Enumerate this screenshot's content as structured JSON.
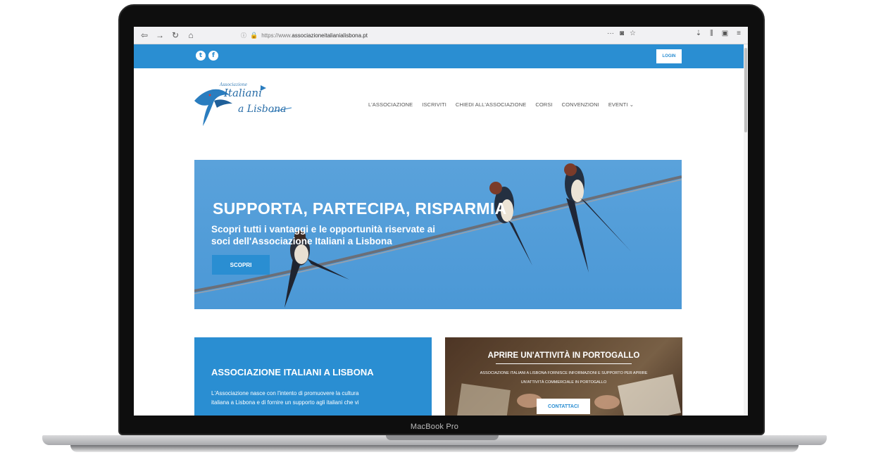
{
  "device": {
    "label": "MacBook Pro"
  },
  "browser": {
    "url_prefix": "https://www.",
    "url_domain": "associazioneitalianialisbona.pt",
    "icons": [
      "back-icon",
      "forward-icon",
      "reload-icon",
      "home-icon",
      "info-icon",
      "lock-icon",
      "more-icon",
      "pocket-icon",
      "bookmark-star-icon",
      "download-icon",
      "library-icon",
      "sidebar-icon",
      "menu-icon"
    ]
  },
  "site": {
    "colors": {
      "primary": "#2a8ed2",
      "hero_bg": "#5aa2db"
    },
    "topbar": {
      "social": [
        "t",
        "f"
      ],
      "login_label": "LOGIN"
    },
    "logo": {
      "small": "Associazione",
      "line1": "Italiani",
      "line2": "a Lisbona"
    },
    "nav": [
      {
        "label": "L'ASSOCIAZIONE"
      },
      {
        "label": "ISCRIVITI"
      },
      {
        "label": "CHIEDI ALL'ASSOCIAZIONE"
      },
      {
        "label": "CORSI"
      },
      {
        "label": "CONVENZIONI"
      },
      {
        "label": "EVENTI"
      }
    ],
    "hero": {
      "title": "SUPPORTA, PARTECIPA, RISPARMIA",
      "subtitle_line1": "Scopri tutti i vantaggi e le opportunità riservate ai",
      "subtitle_line2": "soci dell'Associazione Italiani a Lisbona",
      "button_label": "SCOPRI"
    },
    "panel_left": {
      "title": "ASSOCIAZIONE ITALIANI A LISBONA",
      "text_line1": "L'Associazione nasce con l'intento di promuovere la cultura",
      "text_line2": "italiana a Lisbona e di fornire un supporto agli italiani che vi"
    },
    "panel_right": {
      "title": "APRIRE UN'ATTIVITÀ IN PORTOGALLO",
      "text_line1": "ASSOCIAZIONE ITALIANI A LISBONA FORNISCE INFORMAZIONI E SUPPORTO PER APRIRE",
      "text_line2": "UN'ATTIVITÀ COMMERCIALE IN PORTOGALLO",
      "button_label": "CONTATTACI"
    }
  }
}
